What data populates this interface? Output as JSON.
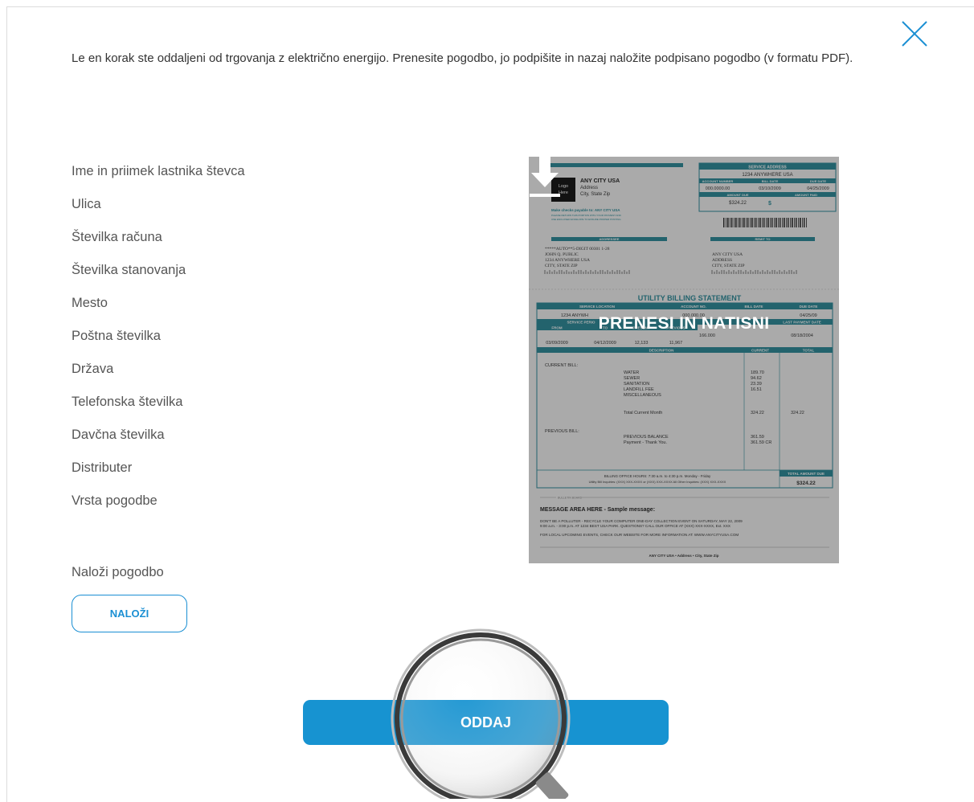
{
  "intro": "Le en korak ste oddaljeni od trgovanja z električno energijo. Prenesite pogodbo, jo podpišite in nazaj naložite podpisano pogodbo (v formatu PDF).",
  "fields": [
    "Ime in priimek lastnika števca",
    "Ulica",
    "Številka računa",
    "Številka stanovanja",
    "Mesto",
    "Poštna številka",
    "Država",
    "Telefonska številka",
    "Davčna številka",
    "Distributer",
    "Vrsta pogodbe"
  ],
  "upload": {
    "title": "Naloži pogodbo",
    "button": "NALOŽI"
  },
  "submit": "ODDAJ",
  "download_overlay": "PRENESI IN NATISNI",
  "icons": {
    "close": "close-icon",
    "download": "download-icon",
    "magnifier": "magnifier-icon"
  },
  "colors": {
    "accent": "#1793d1",
    "document_teal": "#2a8a98"
  },
  "bill": {
    "service_address_label": "SERVICE ADDRESS",
    "service_address": "1234 ANYWHERE USA",
    "account_number_label": "ACCOUNT NUMBER",
    "bill_date_label": "BILL DATE",
    "due_date_label": "DUE DATE",
    "account_number": "000.0000.00",
    "bill_date": "03/10/2009",
    "due_date": "04/25/2009",
    "amount_due_label": "AMOUNT DUE",
    "amount_paid_label": "AMOUNT PAID",
    "amount_due": "$324.22",
    "dollar": "$",
    "logo": [
      "Logo",
      "Here"
    ],
    "company": "ANY CITY USA",
    "company_address": "Address",
    "company_city": "City, State Zip",
    "payable_note": "Make checks payable to: ANY CITY USA",
    "return_note_1": "PLEASE RETURN THIS PORTION WITH YOUR PAYMENT AND",
    "return_note_2": "USE ENCLOSED ENVELOPE TO ENSURE PROPER POSTING",
    "addressee_label": "ADDRESSEE",
    "remit_label": "REMIT TO",
    "addressee": [
      "*****AUTO**5-DIGIT 00301          1-28",
      "JOHN Q. PUBLIC",
      "1234 ANYWHERE USA",
      "CITY, STATE ZIP"
    ],
    "remit": [
      "ANY CITY USA",
      "ADDRESS",
      "CITY, STATE ZIP"
    ],
    "statement_title": "UTILITY BILLING STATEMENT",
    "h_service_location": "SERVICE LOCATION",
    "h_account_no": "ACCOUNT NO.",
    "h_bill_date": "BILL DATE",
    "h_due_date": "DUE DATE",
    "r_service_location": "1234 ANYWH",
    "r_account_no": "000.000.00",
    "r_due_date": "04/25/09",
    "h_service_period": "SERVICE PERIO",
    "h_last_payment": "LAST PAYMENT DATE",
    "h_from": "FROM",
    "h_to": "TO",
    "h_present": "PRESENT",
    "h_previous": "PREVIOUS",
    "r_from": "03/09/2009",
    "r_to": "04/12/2009",
    "r_present": "12,133",
    "r_previous": "11,967",
    "r_usage": "166.000",
    "r_last_payment": "08/18/2004",
    "h_description": "DESCRIPTION",
    "h_current": "CURRENT",
    "h_total": "TOTAL",
    "current_bill_label": "CURRENT BILL:",
    "items": [
      "WATER",
      "SEWER",
      "SANITATION",
      "LANDFILL FEE",
      "MISCELLANEOUS"
    ],
    "item_values": [
      "189.70",
      "94.62",
      "23.39",
      "16.51",
      ""
    ],
    "total_current_month": "Total Current Month",
    "total_current_value": "324.22",
    "total_value": "324.22",
    "previous_bill_label": "PREVIOUS BILL:",
    "previous_balance": "PREVIOUS BALANCE",
    "payment_thanks": "Payment - Thank You.",
    "previous_balance_value": "361.59",
    "payment_value": "361.59 CR",
    "office_hours": "BILLING OFFICE HOURS:  7:30 a.m. to 4:30 p.m. Monday - Friday",
    "inquiries": "Utility Bill Inquiries: (XXX) XXX-XXXX  or  (XXX) XXX-XXXX    All Other Inquiries:  (XXX) XXX-XXXX",
    "total_amount_due_label": "TOTAL AMOUNT DUE",
    "total_amount_due": "$324.22",
    "bulletin_label": "BULLETIN BOARD",
    "message_title": "MESSAGE AREA HERE  -  Sample message:",
    "message_1": "DON'T BE A POLLUTER - RECYCLE YOUR COMPUTER ONE-DAY COLLECTION EVENT ON SATURDAY, MAY 22, 2009",
    "message_2": "9:00 a.m. - 3:00 p.m. AT 1234 BEST USA PARK. QUESTIONS? CALL OUR OFFICE AT (XXX) XXX-XXXX, Ext. XXX",
    "message_3": "FOR LOCAL UPCOMING EVENTS, CHECK OUR WEBSITE FOR MORE INFORMATION AT:  WWW.ANYCITYUSA.COM",
    "footer": "ANY CITY USA  •  Address  •  City, State Zip"
  }
}
